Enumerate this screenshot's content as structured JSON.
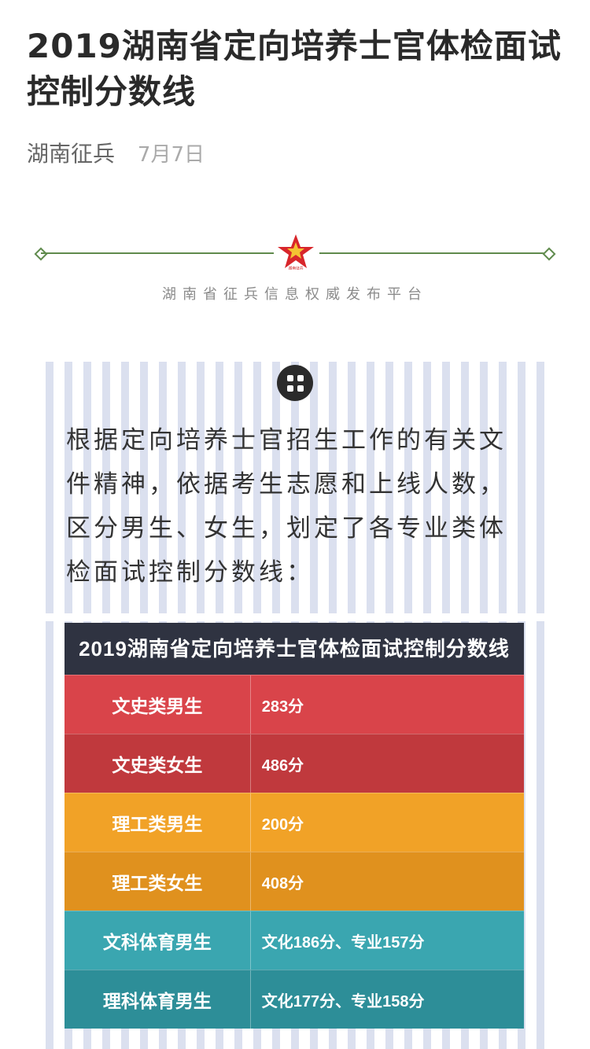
{
  "article": {
    "title": "2019湖南省定向培养士官体检面试控制分数线",
    "account": "湖南征兵",
    "date": "7月7日"
  },
  "banner": {
    "tagline": "湖南省征兵信息权威发布平台",
    "logo_caption": "湖南征兵",
    "icon": "red-star-icon",
    "line_color": "#5f8a4c"
  },
  "paragraph": "根据定向培养士官招生工作的有关文件精神，依据考生志愿和上线人数，区分男生、女生，划定了各专业类体检面试控制分数线：",
  "table": {
    "header": "2019湖南省定向培养士官体检面试控制分数线",
    "rows": [
      {
        "label": "文史类男生",
        "value": "283分",
        "color": "#d9444a"
      },
      {
        "label": "文史类女生",
        "value": "486分",
        "color": "#c0393d"
      },
      {
        "label": "理工类男生",
        "value": "200分",
        "color": "#f1a227"
      },
      {
        "label": "理工类女生",
        "value": "408分",
        "color": "#e0911e"
      },
      {
        "label": "文科体育男生",
        "value": "文化186分、专业157分",
        "color": "#3aa6b0"
      },
      {
        "label": "理科体育男生",
        "value": "文化177分、专业158分",
        "color": "#2d8e98"
      }
    ]
  }
}
